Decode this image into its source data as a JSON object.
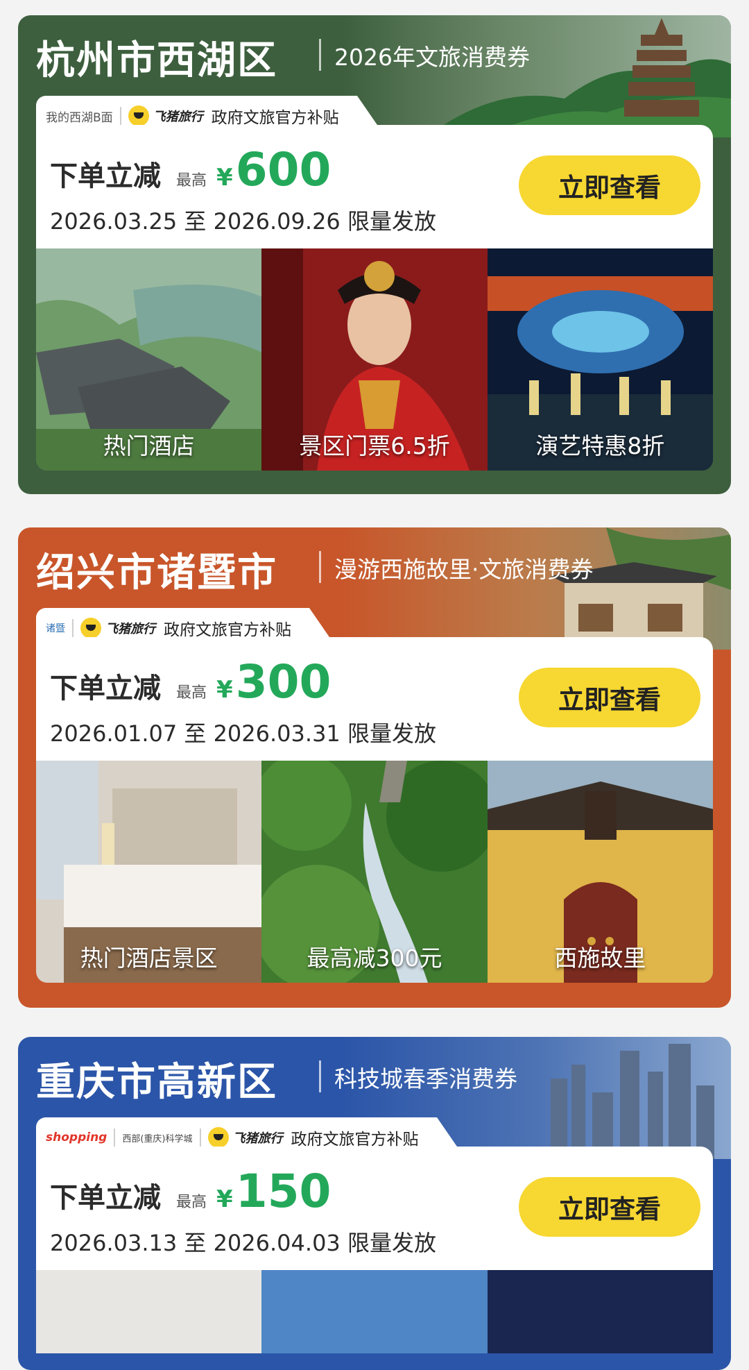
{
  "cards": [
    {
      "city": "杭州市西湖区",
      "tagline": "2026年文旅消费券",
      "partner_logo_text": "我的西湖B面",
      "brand": "飞猪旅行",
      "subsidy": "政府文旅官方补贴",
      "deal_label": "下单立减",
      "max_label": "最高",
      "currency": "¥",
      "amount": "600",
      "date_range": "2026.03.25 至 2026.09.26 限量发放",
      "cta": "立即查看",
      "theme_color": "#3d5f3e",
      "tiles": [
        {
          "caption": "热门酒店",
          "icon": "hotel-photo"
        },
        {
          "caption": "景区门票6.5折",
          "icon": "performer-photo"
        },
        {
          "caption": "演艺特惠8折",
          "icon": "stage-show-photo"
        }
      ]
    },
    {
      "city": "绍兴市诸暨市",
      "tagline": "漫游西施故里·文旅消费券",
      "partner_logo_text": "诸暨",
      "brand": "飞猪旅行",
      "subsidy": "政府文旅官方补贴",
      "deal_label": "下单立减",
      "max_label": "最高",
      "currency": "¥",
      "amount": "300",
      "date_range": "2026.01.07 至 2026.03.31 限量发放",
      "cta": "立即查看",
      "theme_color": "#c8562a",
      "tiles": [
        {
          "caption": "热门酒店景区",
          "icon": "hotel-room-photo"
        },
        {
          "caption": "最高减300元",
          "icon": "waterfall-photo"
        },
        {
          "caption": "西施故里",
          "icon": "temple-gate-photo"
        }
      ]
    },
    {
      "city": "重庆市高新区",
      "tagline": "科技城春季消费券",
      "partner_logo_text": "shopping",
      "partner_logo_text2": "西部(重庆)科学城",
      "brand": "飞猪旅行",
      "subsidy": "政府文旅官方补贴",
      "deal_label": "下单立减",
      "max_label": "最高",
      "currency": "¥",
      "amount": "150",
      "date_range": "2026.03.13 至 2026.04.03 限量发放",
      "cta": "立即查看",
      "theme_color": "#2b55a8",
      "tiles": [
        {
          "caption": "",
          "icon": "hotel-photo"
        },
        {
          "caption": "",
          "icon": "sky-photo"
        },
        {
          "caption": "",
          "icon": "night-photo"
        }
      ]
    }
  ]
}
